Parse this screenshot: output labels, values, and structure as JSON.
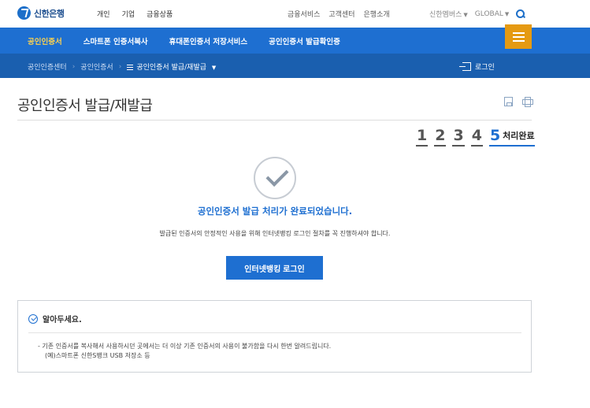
{
  "brand": {
    "name": "신한은행",
    "color": "#1e6fd1"
  },
  "topnav": [
    "개인",
    "기업",
    "금융상품"
  ],
  "util": [
    "금융서비스",
    "고객센터",
    "은행소개"
  ],
  "right_util": {
    "members": "신한멤버스",
    "global": "GLOBAL",
    "search_icon": "search-icon"
  },
  "mainnav": {
    "items": [
      "공인인증서",
      "스마트폰 인증서복사",
      "휴대폰인증서 저장서비스",
      "공인인증서 발급확인증"
    ],
    "active_index": 0,
    "menu_icon": "hamburger-icon"
  },
  "breadcrumb": {
    "items": [
      "공인인증센터",
      "공인인증서"
    ],
    "current": "공인인증서 발급/재발급"
  },
  "login_link": "로그인",
  "page": {
    "title": "공인인증서 발급/재발급"
  },
  "steps": {
    "items": [
      "1",
      "2",
      "3",
      "4"
    ],
    "current_num": "5",
    "current_label": "처리완료"
  },
  "result": {
    "message": "공인인증서 발급 처리가 완료되었습니다.",
    "sub": "발급된 인증서의 안정적인 사용을 위해 인터넷뱅킹 로그인 절차를 꼭 진행하셔야 합니다.",
    "button": "인터넷뱅킹 로그인"
  },
  "notice": {
    "title": "알아두세요.",
    "line1": "- 기존 인증서를 복사해서 사용하시던 곳에서는 더 이상 기존 인증서의 사용이 불가함을 다시 한번 알려드립니다.",
    "line2": "(예)스마트폰 신한S뱅크 USB 저장소 등"
  },
  "colors": {
    "accent": "#1e6fd1",
    "menu_button": "#e59a12",
    "active_nav": "#ffd34d"
  }
}
